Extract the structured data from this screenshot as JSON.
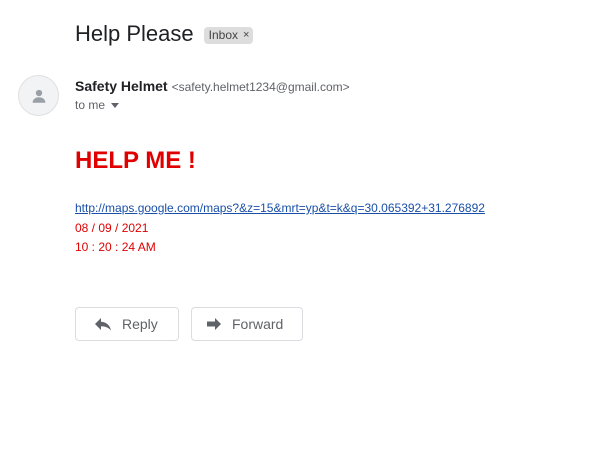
{
  "message": {
    "subject": "Help Please",
    "label_chip": "Inbox",
    "label_remove_glyph": "×",
    "sender_name": "Safety Helmet",
    "sender_email": "<safety.helmet1234@gmail.com>",
    "recipient_text": "to me",
    "body": {
      "headline": "HELP ME !",
      "link": "http://maps.google.com/maps?&z=15&mrt=yp&t=k&q=30.065392+31.276892",
      "date": "08 / 09 / 2021",
      "time": "10 : 20 : 24 AM"
    }
  },
  "actions": {
    "reply_label": "Reply",
    "forward_label": "Forward"
  },
  "icons": {
    "avatar": "person-icon",
    "recipient_details": "caret-down-icon",
    "reply": "reply-arrow-icon",
    "forward": "forward-arrow-icon"
  },
  "colors": {
    "headline": "#e00000",
    "link": "#1a4fa8",
    "chip_bg": "#dddddd"
  }
}
